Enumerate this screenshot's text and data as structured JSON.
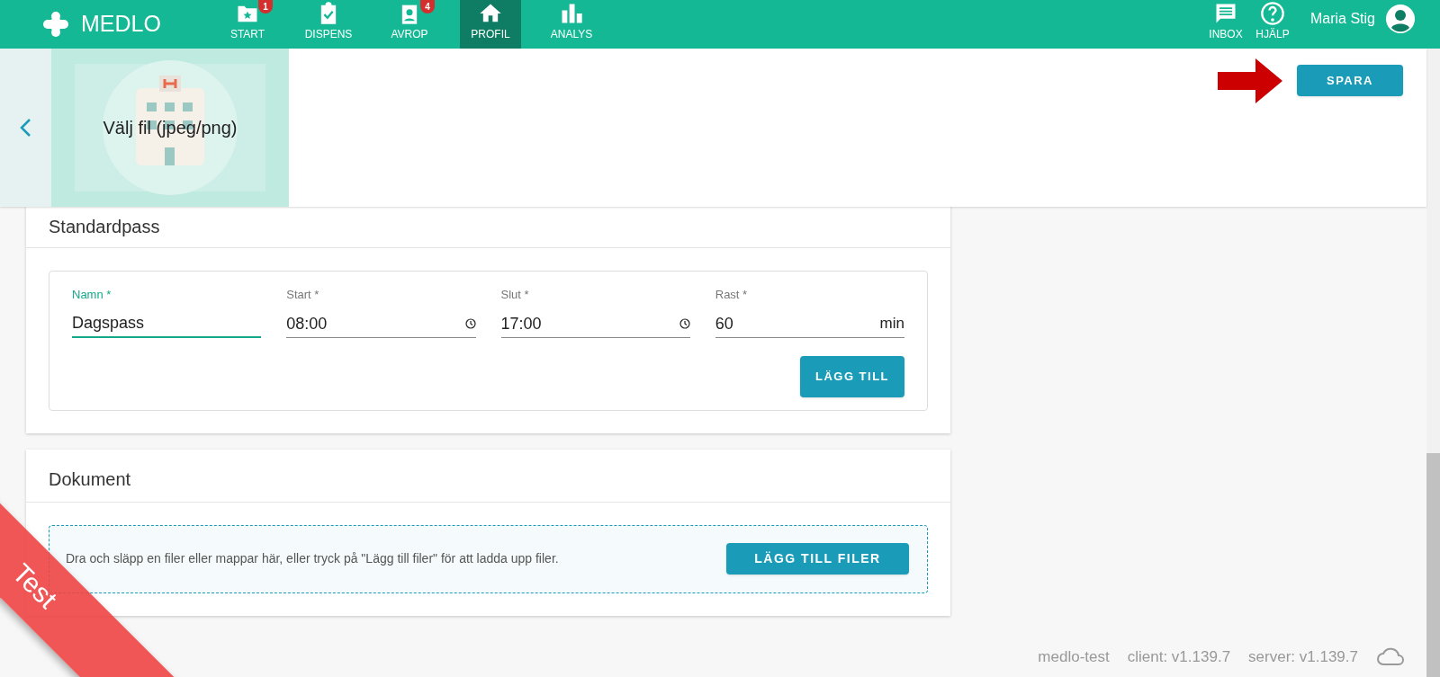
{
  "header": {
    "logo": "MEDLO",
    "nav": [
      {
        "label": "START",
        "badge": "1",
        "selected": false
      },
      {
        "label": "DISPENS",
        "selected": false
      },
      {
        "label": "AVROP",
        "badge": "4",
        "selected": false
      },
      {
        "label": "PROFIL",
        "selected": true
      },
      {
        "label": "ANALYS",
        "selected": false
      }
    ],
    "actions": [
      {
        "label": "INBOX"
      },
      {
        "label": "HJÄLP"
      }
    ],
    "user": "Maria Stig"
  },
  "profile_bar": {
    "image_label": "Välj fil (jpeg/png)",
    "save_button": "SPARA"
  },
  "standardpass": {
    "title": "Standardpass",
    "fields": [
      {
        "kind": "text",
        "label": "Namn *",
        "value": "Dagspass",
        "focused": true
      },
      {
        "kind": "time",
        "label": "Start *",
        "value": "08:00",
        "focused": false
      },
      {
        "kind": "time",
        "label": "Slut *",
        "value": "17:00",
        "focused": false
      },
      {
        "kind": "number",
        "label": "Rast *",
        "value": "60",
        "suffix": "min",
        "focused": false
      }
    ],
    "add_button": "LÄGG TILL"
  },
  "dokument": {
    "title": "Dokument",
    "drop_hint": "Dra och släpp en filer eller mappar här, eller tryck på \"Lägg till filer\" för att ladda upp filer.",
    "add_button": "LÄGG TILL FILER"
  },
  "footer": {
    "items": [
      "medlo-test",
      "client: v1.139.7",
      "server: v1.139.7"
    ]
  },
  "ribbon": "Test"
}
